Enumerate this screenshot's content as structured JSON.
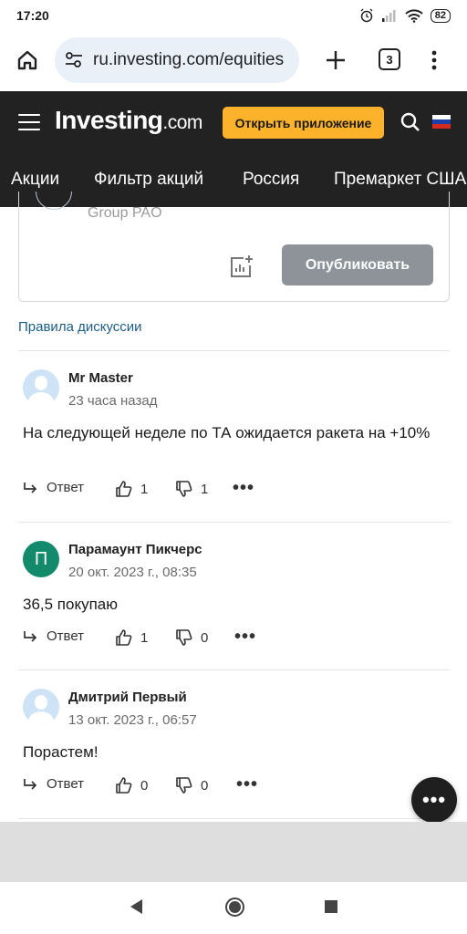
{
  "status_bar": {
    "time": "17:20",
    "battery": "82"
  },
  "browser": {
    "url": "ru.investing.com/equities",
    "tab_count": "3"
  },
  "header": {
    "logo_main": "Investing",
    "logo_suffix": ".com",
    "open_app_label": "Открыть приложение",
    "flag_colors": [
      "#ffffff",
      "#1c3faa",
      "#d52b1e"
    ]
  },
  "nav_tabs": [
    "Акции",
    "Фильтр акций",
    "Россия",
    "Премаркет США"
  ],
  "post_box": {
    "company_fragment": "Group PAO",
    "publish_label": "Опубликовать"
  },
  "rules_link": "Правила дискуссии",
  "comments": [
    {
      "author": "Mr Master",
      "time": "23 часа назад",
      "text": "На следующей неделе по ТА ожидается ракета на +10%",
      "reply_label": "Ответ",
      "likes": "1",
      "dislikes": "1",
      "avatar": "default"
    },
    {
      "author": "Парамаунт Пикчерс",
      "time": "20 окт. 2023 г., 08:35",
      "text": "36,5 покупаю",
      "reply_label": "Ответ",
      "likes": "1",
      "dislikes": "0",
      "avatar": "letter",
      "avatar_letter": "П"
    },
    {
      "author": "Дмитрий Первый",
      "time": "13 окт. 2023 г., 06:57",
      "text": "Порастем!",
      "reply_label": "Ответ",
      "likes": "0",
      "dislikes": "0",
      "avatar": "default"
    }
  ],
  "colors": {
    "header_bg": "#222222",
    "accent": "#fdb22b",
    "link": "#1d5d86",
    "publish_btn": "#8e939a",
    "avatar_letter_bg": "#138a6c"
  }
}
